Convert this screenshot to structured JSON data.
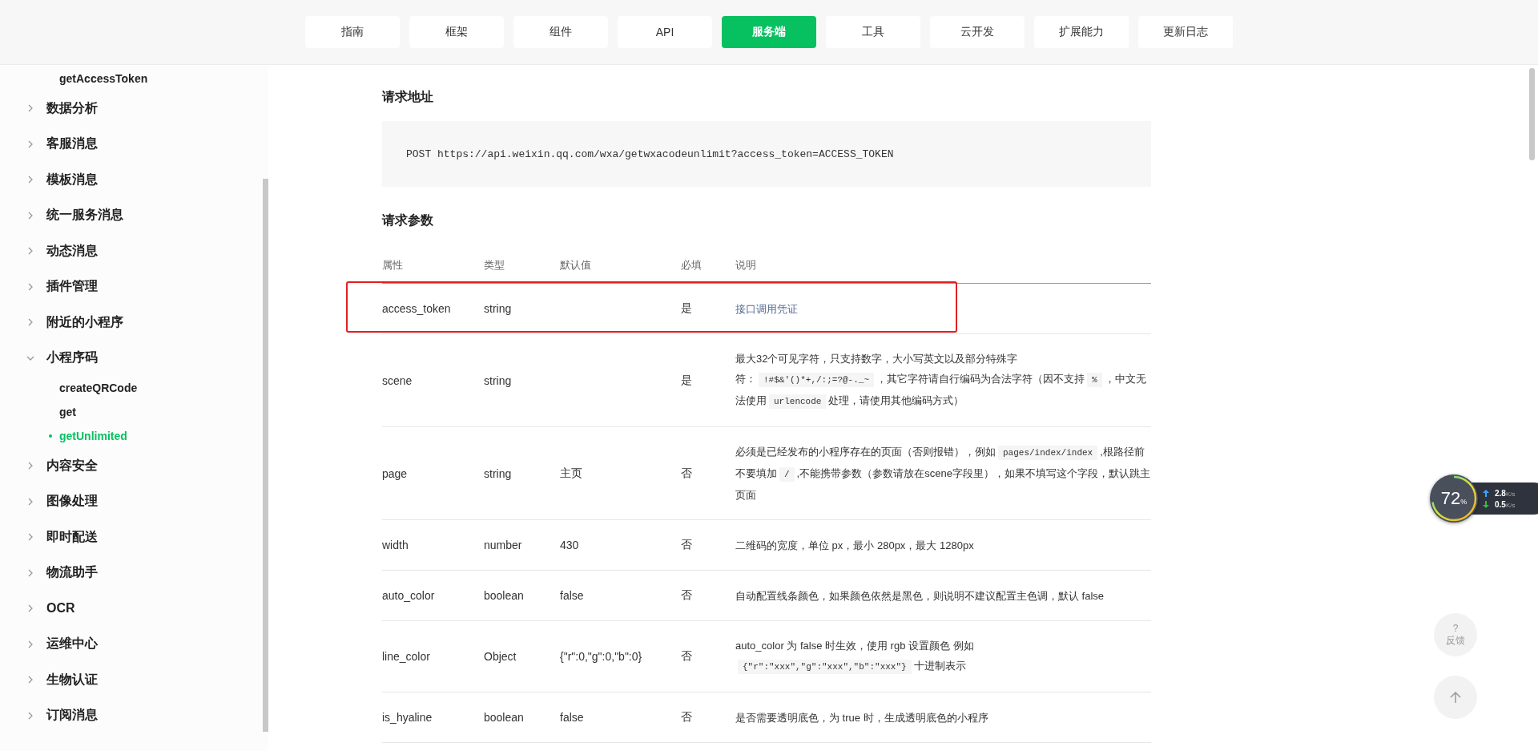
{
  "nav": {
    "tabs": [
      {
        "label": "指南",
        "selected": false
      },
      {
        "label": "框架",
        "selected": false
      },
      {
        "label": "组件",
        "selected": false
      },
      {
        "label": "API",
        "selected": false
      },
      {
        "label": "服务端",
        "selected": true
      },
      {
        "label": "工具",
        "selected": false
      },
      {
        "label": "云开发",
        "selected": false
      },
      {
        "label": "扩展能力",
        "selected": false
      },
      {
        "label": "更新日志",
        "selected": false
      }
    ]
  },
  "sidebar": {
    "items": [
      {
        "kind": "child",
        "label": "getAccessToken",
        "selected": false
      },
      {
        "kind": "group",
        "label": "数据分析",
        "expanded": false
      },
      {
        "kind": "group",
        "label": "客服消息",
        "expanded": false
      },
      {
        "kind": "group",
        "label": "模板消息",
        "expanded": false
      },
      {
        "kind": "group",
        "label": "统一服务消息",
        "expanded": false
      },
      {
        "kind": "group",
        "label": "动态消息",
        "expanded": false
      },
      {
        "kind": "group",
        "label": "插件管理",
        "expanded": false
      },
      {
        "kind": "group",
        "label": "附近的小程序",
        "expanded": false
      },
      {
        "kind": "group",
        "label": "小程序码",
        "expanded": true,
        "children": [
          {
            "label": "createQRCode",
            "selected": false
          },
          {
            "label": "get",
            "selected": false
          },
          {
            "label": "getUnlimited",
            "selected": true
          }
        ]
      },
      {
        "kind": "group",
        "label": "内容安全",
        "expanded": false
      },
      {
        "kind": "group",
        "label": "图像处理",
        "expanded": false
      },
      {
        "kind": "group",
        "label": "即时配送",
        "expanded": false
      },
      {
        "kind": "group",
        "label": "物流助手",
        "expanded": false
      },
      {
        "kind": "group",
        "label": "OCR",
        "expanded": false
      },
      {
        "kind": "group",
        "label": "运维中心",
        "expanded": false
      },
      {
        "kind": "group",
        "label": "生物认证",
        "expanded": false
      },
      {
        "kind": "group",
        "label": "订阅消息",
        "expanded": false
      }
    ]
  },
  "content": {
    "request_heading": "请求地址",
    "request_url": "POST https://api.weixin.qq.com/wxa/getwxacodeunlimit?access_token=ACCESS_TOKEN",
    "params_heading": "请求参数",
    "table": {
      "columns": [
        "属性",
        "类型",
        "默认值",
        "必填",
        "说明"
      ],
      "rows": [
        {
          "name": "access_token",
          "type": "string",
          "default": "",
          "required": "是",
          "highlighted": true,
          "description": [
            {
              "kind": "text",
              "text": "接口调用凭证"
            }
          ]
        },
        {
          "name": "scene",
          "type": "string",
          "default": "",
          "required": "是",
          "highlighted": false,
          "description": [
            {
              "kind": "text",
              "text": "最大32个可见字符，只支持数字，大小写英文以及部分特殊字符："
            },
            {
              "kind": "code",
              "text": "!#$&'()*+,/:;=?@-._~"
            },
            {
              "kind": "text",
              "text": "，其它字符请自行编码为合法字符（因不支持"
            },
            {
              "kind": "code",
              "text": "%"
            },
            {
              "kind": "text",
              "text": "，中文无法使用"
            },
            {
              "kind": "code",
              "text": "urlencode"
            },
            {
              "kind": "text",
              "text": "处理，请使用其他编码方式）"
            }
          ]
        },
        {
          "name": "page",
          "type": "string",
          "default": "主页",
          "required": "否",
          "highlighted": false,
          "description": [
            {
              "kind": "text",
              "text": "必须是已经发布的小程序存在的页面（否则报错），例如"
            },
            {
              "kind": "code",
              "text": "pages/index/index"
            },
            {
              "kind": "text",
              "text": ",根路径前不要填加"
            },
            {
              "kind": "code",
              "text": "/"
            },
            {
              "kind": "text",
              "text": ",不能携带参数（参数请放在scene字段里），如果不填写这个字段，默认跳主页面"
            }
          ]
        },
        {
          "name": "width",
          "type": "number",
          "default": "430",
          "required": "否",
          "highlighted": false,
          "description": [
            {
              "kind": "text",
              "text": "二维码的宽度，单位 px，最小 280px，最大 1280px"
            }
          ]
        },
        {
          "name": "auto_color",
          "type": "boolean",
          "default": "false",
          "required": "否",
          "highlighted": false,
          "description": [
            {
              "kind": "text",
              "text": "自动配置线条颜色，如果颜色依然是黑色，则说明不建议配置主色调，默认 false"
            }
          ]
        },
        {
          "name": "line_color",
          "type": "Object",
          "default": "{\"r\":0,\"g\":0,\"b\":0}",
          "required": "否",
          "highlighted": false,
          "description": [
            {
              "kind": "text",
              "text": "auto_color 为 false 时生效，使用 rgb 设置颜色 例如"
            },
            {
              "kind": "code",
              "text": "{\"r\":\"xxx\",\"g\":\"xxx\",\"b\":\"xxx\"}"
            },
            {
              "kind": "text",
              "text": "十进制表示"
            }
          ]
        },
        {
          "name": "is_hyaline",
          "type": "boolean",
          "default": "false",
          "required": "否",
          "highlighted": false,
          "description": [
            {
              "kind": "text",
              "text": "是否需要透明底色，为 true 时，生成透明底色的小程序"
            }
          ]
        }
      ]
    }
  },
  "monitor": {
    "reading": "72",
    "unit": "%",
    "upload": "2.8",
    "upload_unit": "K/s",
    "download": "0.5",
    "download_unit": "K/s"
  },
  "feedback": {
    "mark": "?",
    "label": "反馈"
  }
}
